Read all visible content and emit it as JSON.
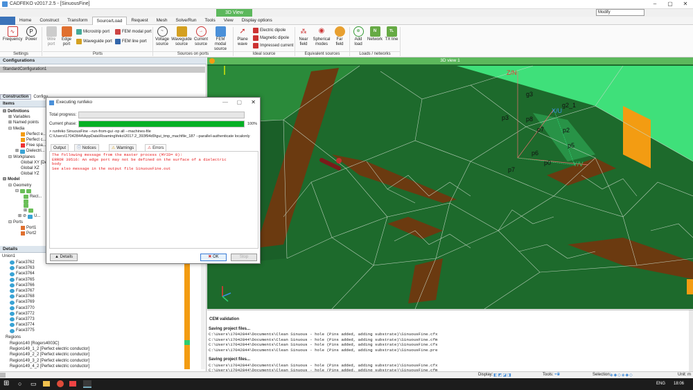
{
  "app": {
    "title": "CADFEKO v2017.2.5 - [SinuousFine]",
    "context_tab": "3D View"
  },
  "tabs": [
    "Home",
    "Construct",
    "Transform",
    "Source/Load",
    "Request",
    "Mesh",
    "Solve/Run",
    "Tools",
    "View",
    "Display options"
  ],
  "active_tab": "Source/Load",
  "mode_select": "Modify",
  "ribbon": {
    "settings": {
      "group": "Settings",
      "buttons": [
        "Frequency",
        "Power"
      ]
    },
    "ports": {
      "group": "Ports",
      "wire_port": "Wire port",
      "edge_port": "Edge port",
      "small": [
        "Microstrip port",
        "Waveguide port",
        "FEM modal port",
        "FEM line port"
      ]
    },
    "sources": {
      "group": "Sources on ports",
      "buttons": [
        "Voltage source",
        "Waveguide source",
        "Current source",
        "FEM modal source"
      ]
    },
    "ideal": {
      "group": "Ideal source",
      "plane_wave": "Plane wave",
      "small": [
        "Electric dipole",
        "Magnetic dipole",
        "Impressed current"
      ]
    },
    "equiv": {
      "group": "Equivalent sources",
      "buttons": [
        "Near field",
        "Spherical modes",
        "Far field"
      ]
    },
    "loads": {
      "group": "Loads / networks",
      "buttons": [
        "Add load",
        "Network",
        "TX line"
      ]
    }
  },
  "configurations": {
    "header": "Configurations",
    "item": "StandardConfiguration1"
  },
  "construction_tabs": [
    "Construction",
    "Configu..."
  ],
  "items_header": "Items",
  "tree": [
    "Definitions",
    "Variables",
    "Named points",
    "Media",
    "Perfect e...",
    "Perfect c...",
    "Free spa...",
    "Dielectri...",
    "Workplanes",
    "Global XY [De...",
    "Global XZ",
    "Global YZ",
    "Model",
    "Geometry",
    "Rect...",
    "",
    "",
    "",
    "U...",
    "Ports",
    "Port1",
    "Port2"
  ],
  "details": {
    "header": "Details",
    "root": "Union1",
    "faces": [
      "Face3762",
      "Face3763",
      "Face3764",
      "Face3765",
      "Face3766",
      "Face3767",
      "Face3768",
      "Face3769",
      "Face3770",
      "Face3772",
      "Face3773",
      "Face3774",
      "Face3775"
    ],
    "regions_label": "Regions",
    "regions": [
      "Region140 [Rogers4003C]",
      "Region149_1_2 [Perfect electric conductor]",
      "Region149_2_2 [Perfect electric conductor]",
      "Region149_3_2 [Perfect electric conductor]",
      "Region149_4_2 [Perfect electric conductor]"
    ]
  },
  "view": {
    "title": "3D view 1",
    "axis_labels": [
      "Z/N",
      "X/U",
      "Y/V"
    ],
    "point_labels": [
      "g3",
      "g2_1",
      "p3",
      "p8",
      "p7",
      "p2",
      "p5",
      "p6",
      "p0",
      "p7"
    ]
  },
  "dialog": {
    "title": "Executing runfeko",
    "total_progress_label": "Total progress:",
    "current_phase_label": "Current phase:",
    "current_phase_pct": "100%",
    "current_phase_fraction": 1.0,
    "command": "> runfeko SinuousFine --run-from-gui -np all --machines-file C:\\Users\\17042844\\AppData\\Roaming\\feko\\2017.2_393f94d9\\gui_tmp_machfile_187 --parallel-authenticate localonly",
    "tabs": [
      "Output",
      "Notices",
      "Warnings",
      "Errors"
    ],
    "active_tab": "Errors",
    "errors": [
      "The following message from the master process (MYID= 0):",
      "ERROR 39516: An edge port may not be defined on the surface of a dielectric",
      "body",
      "See also message in the output file SinuousFine.out"
    ],
    "details_btn": "Details",
    "ok_btn": "OK",
    "stop_btn": "Stop"
  },
  "output": {
    "title": "CEM validation",
    "lines": [
      {
        "bold": true,
        "text": "Saving project files..."
      },
      {
        "bold": false,
        "text": "C:\\Users\\17042844\\Documents\\Clean Sinuous - hole (Pins added, adding substrate)\\SinuousFine.cfx"
      },
      {
        "bold": false,
        "text": "C:\\Users\\17042844\\Documents\\Clean Sinuous - hole (Pins added, adding substrate)\\SinuousFine.cfm"
      },
      {
        "bold": false,
        "text": "C:\\Users\\17042844\\Documents\\Clean Sinuous - hole (Pins added, adding substrate)\\SinuousFine.cfs"
      },
      {
        "bold": false,
        "text": "C:\\Users\\17042844\\Documents\\Clean Sinuous - hole (Pins added, adding substrate)\\SinuousFine.pre"
      },
      {
        "bold": false,
        "text": ""
      },
      {
        "bold": true,
        "text": "Saving project files..."
      },
      {
        "bold": false,
        "text": "C:\\Users\\17042844\\Documents\\Clean Sinuous - hole (Pins added, adding substrate)\\SinuousFine.cfx"
      },
      {
        "bold": false,
        "text": "C:\\Users\\17042844\\Documents\\Clean Sinuous - hole (Pins added, adding substrate)\\SinuousFine.cfm"
      },
      {
        "bold": false,
        "text": "C:\\Users\\17042844\\Documents\\Clean Sinuous - hole (Pins added, adding substrate)\\SinuousFine.cfs"
      },
      {
        "bold": false,
        "text": "C:\\Users\\17042844\\Documents\\Clean Sinuous - hole (Pins added, adding substrate)\\SinuousFine.pre"
      }
    ]
  },
  "status": {
    "display": "Display:",
    "tools": "Tools:",
    "selection": "Selection:",
    "units": "Unit: m"
  },
  "taskbar": {
    "lang": "ENG",
    "time": "18:06"
  },
  "colors": {
    "green_dark": "#1f6b2e",
    "green_light": "#3fe07a",
    "brown": "#6b3a10",
    "orange": "#f39c12",
    "accent": "#5cb85c"
  }
}
